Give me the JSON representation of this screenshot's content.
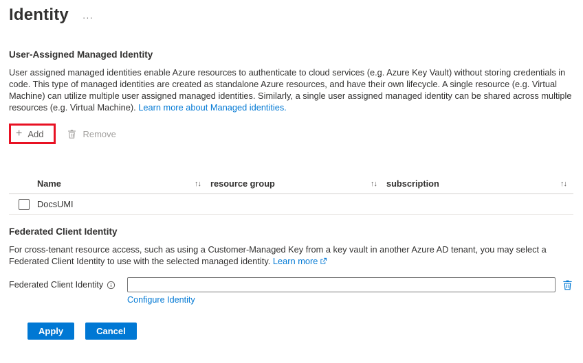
{
  "page": {
    "title": "Identity",
    "more_actions": "···"
  },
  "uami": {
    "heading": "User-Assigned Managed Identity",
    "description": "User assigned managed identities enable Azure resources to authenticate to cloud services (e.g. Azure Key Vault) without storing credentials in code. This type of managed identities are created as standalone Azure resources, and have their own lifecycle. A single resource (e.g. Virtual Machine) can utilize multiple user assigned managed identities. Similarly, a single user assigned managed identity can be shared across multiple resources (e.g. Virtual Machine).",
    "learn_more_link": "Learn more about Managed identities.",
    "toolbar": {
      "add_label": "Add",
      "add_icon": "+",
      "remove_label": "Remove"
    },
    "table": {
      "sort_icon": "↑↓",
      "columns": [
        {
          "label": "Name"
        },
        {
          "label": "resource group"
        },
        {
          "label": "subscription"
        }
      ],
      "rows": [
        {
          "name": "DocsUMI",
          "checked": false
        }
      ]
    }
  },
  "federated": {
    "heading": "Federated Client Identity",
    "description": "For cross-tenant resource access, such as using a Customer-Managed Key from a key vault in another Azure AD tenant, you may select a Federated Client Identity to use with the selected managed identity.",
    "learn_more_link": "Learn more",
    "field_label": "Federated Client Identity",
    "input_value": "",
    "configure_link": "Configure Identity"
  },
  "footer": {
    "apply_label": "Apply",
    "cancel_label": "Cancel"
  },
  "colors": {
    "accent": "#0078d4",
    "link": "#0078d4",
    "highlight_border": "#e81123",
    "disabled_text": "#a19f9d",
    "text": "#323130"
  }
}
